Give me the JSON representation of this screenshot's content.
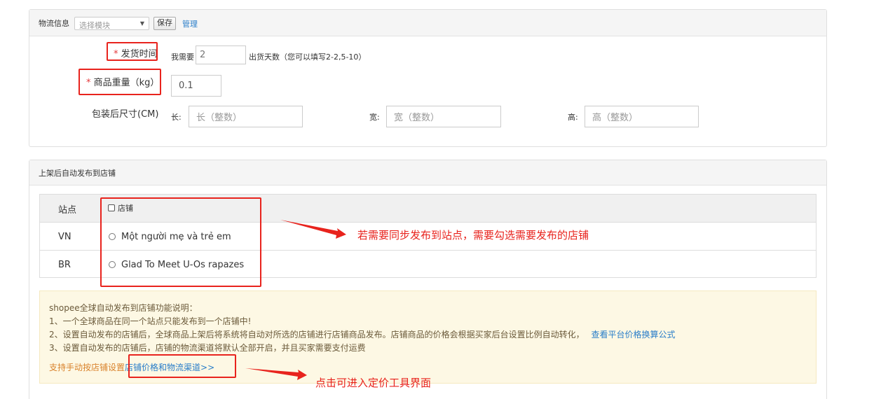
{
  "logistics": {
    "header_label": "物流信息",
    "template_select": {
      "placeholder": "选择模块"
    },
    "save_button": "保存",
    "manage_link": "管理"
  },
  "ship_time": {
    "required_mark": "*",
    "label": "发货时间",
    "prefix": "我需要",
    "value": "2",
    "suffix": "出货天数（您可以填写2-2,5-10）"
  },
  "weight": {
    "required_mark": "*",
    "label": "商品重量（kg）",
    "value": "0.1"
  },
  "dimensions": {
    "label": "包装后尺寸(CM)",
    "length": {
      "label": "长:",
      "placeholder": "长（整数）"
    },
    "width": {
      "label": "宽:",
      "placeholder": "宽（整数）"
    },
    "height": {
      "label": "高:",
      "placeholder": "高（整数）"
    }
  },
  "auto_publish": {
    "header_label": "上架后自动发布到店铺",
    "table": {
      "col_site": "站点",
      "col_shop": "店铺",
      "rows": [
        {
          "site": "VN",
          "shop": "Một người mẹ và trẻ em"
        },
        {
          "site": "BR",
          "shop": "Glad To Meet U-Os rapazes"
        }
      ]
    },
    "notice": {
      "title": "shopee全球自动发布到店铺功能说明：",
      "line1": "1、一个全球商品在同一个站点只能发布到一个店铺中!",
      "line2": "2、设置自动发布的店铺后，全球商品上架后将系统将自动对所选的店铺进行店铺商品发布。店铺商品的价格会根据买家后台设置比例自动转化，",
      "line2_link": "查看平台价格换算公式",
      "line3": "3、设置自动发布的店铺后，店铺的物流渠道将默认全部开启，并且买家需要支付运费",
      "manual_prefix": "支持手动按店铺设置",
      "manual_link": "店铺价格和物流渠道>>"
    }
  },
  "annotations": {
    "shop_note": "若需要同步发布到站点，需要勾选需要发布的店铺",
    "pricing_note": "点击可进入定价工具界面",
    "color": "#e8231d"
  },
  "colors": {
    "link": "#2a7ec9",
    "notice_bg": "#fdf8e4",
    "orange_text": "#d9822b"
  }
}
